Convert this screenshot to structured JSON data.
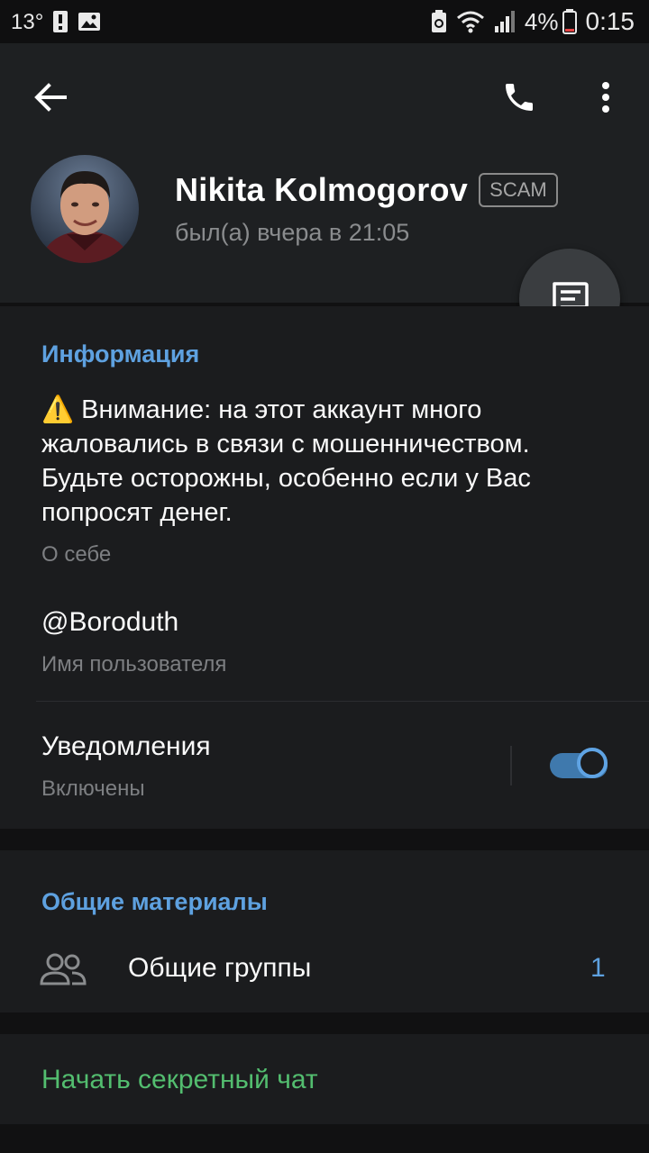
{
  "status_bar": {
    "temperature": "13°",
    "battery": "4%",
    "time": "0:15"
  },
  "header": {
    "name": "Nikita Kolmogorov",
    "badge": "SCAM",
    "last_seen": "был(а) вчера в 21:05"
  },
  "info": {
    "section_title": "Информация",
    "bio": "⚠️ Внимание: на этот аккаунт много жаловались в связи с мошенничеством. Будьте осторожны, особенно если у Вас попросят денег.",
    "bio_caption": "О себе",
    "username": "@Boroduth",
    "username_caption": "Имя пользователя",
    "notifications_label": "Уведомления",
    "notifications_status": "Включены",
    "notifications_on": true
  },
  "shared": {
    "section_title": "Общие материалы",
    "groups_label": "Общие группы",
    "groups_count": "1"
  },
  "secret_chat_label": "Начать секретный чат",
  "colors": {
    "accent": "#5ea1e0",
    "green": "#53bd6f",
    "header_bg": "#1e2022",
    "card_bg": "#1b1c1e"
  }
}
